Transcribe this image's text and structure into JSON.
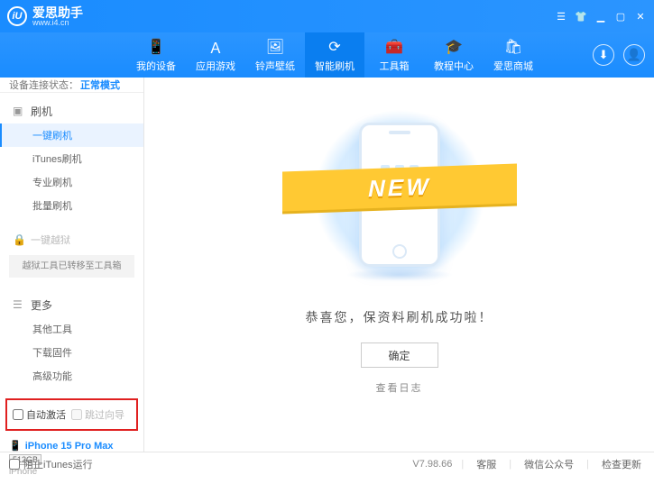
{
  "titlebar": {
    "brand_cn": "爱思助手",
    "brand_url": "www.i4.cn",
    "logo_letter": "iU"
  },
  "nav": {
    "items": [
      {
        "label": "我的设备",
        "icon": "📱"
      },
      {
        "label": "应用游戏",
        "icon": "Ａ"
      },
      {
        "label": "铃声壁纸",
        "icon": "🖼"
      },
      {
        "label": "智能刷机",
        "icon": "⟳"
      },
      {
        "label": "工具箱",
        "icon": "🧰"
      },
      {
        "label": "教程中心",
        "icon": "🎓"
      },
      {
        "label": "爱思商城",
        "icon": "🛍"
      }
    ],
    "active_index": 3
  },
  "status": {
    "label": "设备连接状态：",
    "mode": "正常模式"
  },
  "sidebar": {
    "flash_head": "刷机",
    "items_flash": [
      "一键刷机",
      "iTunes刷机",
      "专业刷机",
      "批量刷机"
    ],
    "flash_active_index": 0,
    "jailbreak_head": "一键越狱",
    "jailbreak_note": "越狱工具已转移至工具箱",
    "more_head": "更多",
    "items_more": [
      "其他工具",
      "下载固件",
      "高级功能"
    ],
    "checkbox_auto_activate": "自动激活",
    "checkbox_skip_guide": "跳过向导"
  },
  "device": {
    "name": "iPhone 15 Pro Max",
    "capacity": "512GB",
    "type": "iPhone"
  },
  "main": {
    "ribbon_text": "NEW",
    "success_text": "恭喜您，保资料刷机成功啦！",
    "ok_label": "确定",
    "view_log": "查看日志"
  },
  "footer": {
    "block_itunes": "阻止iTunes运行",
    "version": "V7.98.66",
    "links": [
      "客服",
      "微信公众号",
      "检查更新"
    ]
  }
}
